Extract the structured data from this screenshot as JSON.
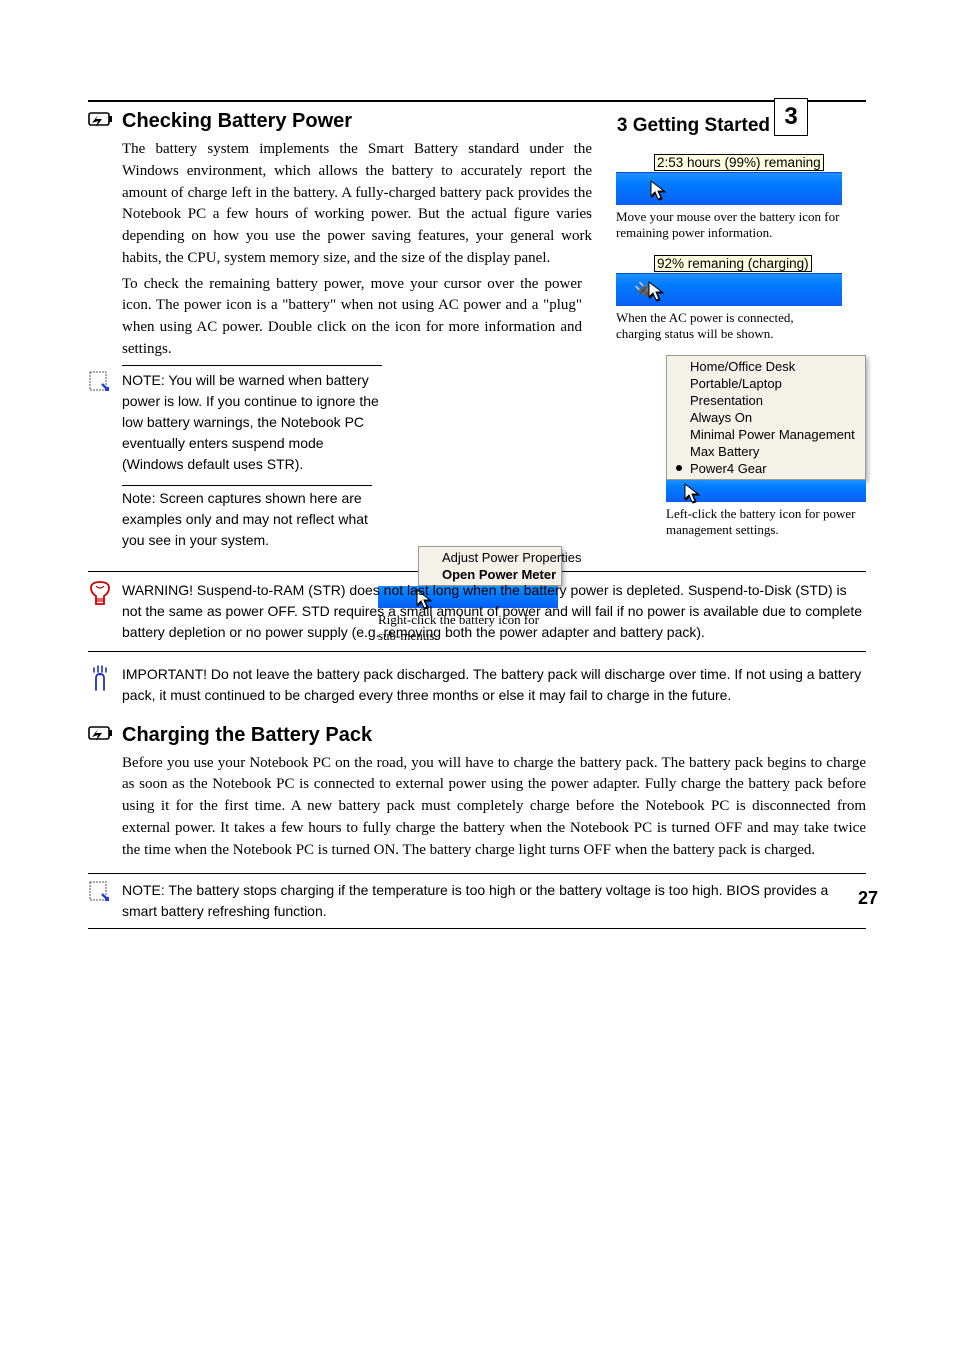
{
  "header": {
    "section_name": "3    Getting Started",
    "corner_label": "3"
  },
  "footer": {
    "page": "27"
  },
  "tooltip1": {
    "text": "2:53 hours (99%) remaning",
    "caption": "Move your mouse over the battery icon for remaining power information."
  },
  "tooltip2": {
    "text": "92% remaning (charging)",
    "caption": "When the AC power is connected, charging status will be shown."
  },
  "menu_right": {
    "items": [
      "Adjust Power Properties",
      "Open Power Meter"
    ],
    "caption": "Right-click the battery icon for sub-menus."
  },
  "menu_left": {
    "items": [
      "Home/Office Desk",
      "Portable/Laptop",
      "Presentation",
      "Always On",
      "Minimal Power Management",
      "Max Battery",
      "Power4 Gear"
    ],
    "selected_index": 6,
    "caption": "Left-click the battery icon for power management settings."
  },
  "s1": {
    "title": "Checking Battery Power",
    "p1": "The battery system implements the Smart Battery standard under the Windows environment, which allows the battery to accurately report the amount of charge left in the battery. A fully-charged battery pack provides the Notebook PC a few hours of working power. But the actual figure varies depending on how you use the power saving features, your general work habits, the CPU, system memory size, and the size of the display panel.",
    "p2": "To check the remaining battery power, move your cursor over the power icon. The power icon is a \"battery\" when not using AC power and a \"plug\" when using AC power. Double click on the icon for more information and settings."
  },
  "note1": {
    "text": "NOTE: You will be warned when battery power is low. If you continue to ignore the low battery warnings, the Notebook PC eventually enters suspend mode (Windows default uses STR)."
  },
  "note2": {
    "text": "Note: Screen captures shown here are examples only and may not reflect what you see in your system."
  },
  "warning": {
    "text": "WARNING! Suspend-to-RAM (STR) does not last long when the battery power is depleted. Suspend-to-Disk (STD) is not the same as power OFF. STD requires a small amount of power and will fail if no power is available due to complete battery depletion or no power supply (e.g. removing both the power adapter and battery pack)."
  },
  "s2": {
    "title": "Charging the Battery Pack",
    "p1": "Before you use your Notebook PC on the road, you will have to charge the battery pack. The battery pack begins to charge as soon as the Notebook PC is connected to external power using the power adapter. Fully charge the battery pack before using it for the first time. A new battery pack must completely charge before the Notebook PC is disconnected from external power. It takes a few hours to fully charge the battery when the Notebook PC is turned OFF and may take twice the time when the Notebook PC is turned ON. The battery charge light turns OFF when the battery pack is charged."
  },
  "note3": {
    "text": "NOTE: The battery stops charging if the temperature is too high or the battery voltage is too high. BIOS provides a smart battery refreshing function."
  },
  "caution": {
    "text": "IMPORTANT! Do not leave the battery pack discharged. The battery pack will discharge over time. If not using a battery pack, it must continued to be charged every three months or else it may fail to charge in the future."
  }
}
